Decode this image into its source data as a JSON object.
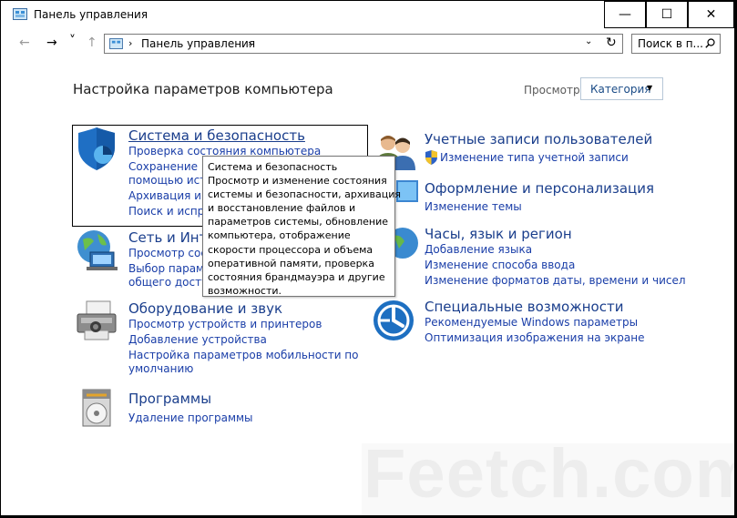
{
  "window": {
    "title": "Панель управления"
  },
  "controls": {
    "minimize": "—",
    "maximize": "☐",
    "close": "✕"
  },
  "nav": {
    "back": "←",
    "forward": "→",
    "recent": "˅",
    "up": "↑"
  },
  "address": {
    "path": "Панель управления",
    "sep1": "›",
    "sep2": "›",
    "dropdown": "⌄",
    "refresh": "↻"
  },
  "search": {
    "placeholder": "Поиск в п..."
  },
  "page": {
    "heading": "Настройка параметров компьютера",
    "view_label": "Просмотр:",
    "view_value": "Категория",
    "view_arrow": "▼"
  },
  "categories": {
    "security": {
      "title": "Система и безопасность",
      "icon": "shield-icon",
      "links": [
        "Проверка состояния компьютера",
        "Сохранение ре",
        "помощью исто",
        "Архивация и во",
        "Поиск и испра"
      ]
    },
    "network": {
      "title": "Сеть и Инте",
      "icon": "network-globe-icon",
      "links": [
        "Просмотр сост",
        "Выбор параме",
        "общего доступ"
      ]
    },
    "hardware": {
      "title": "Оборудование и звук",
      "icon": "printer-icon",
      "links": [
        "Просмотр устройств и принтеров",
        "Добавление устройства",
        "Настройка параметров мобильности по",
        "умолчанию"
      ]
    },
    "programs": {
      "title": "Программы",
      "icon": "programs-disc-icon",
      "links": [
        "Удаление программы"
      ]
    },
    "accounts": {
      "title": "Учетные записи пользователей",
      "icon": "users-icon",
      "links": [
        "Изменение типа учетной записи"
      ]
    },
    "appearance": {
      "title": "Оформление и персонализация",
      "icon": "appearance-icon",
      "links": [
        "Изменение темы"
      ]
    },
    "clock": {
      "title": "Часы, язык и регион",
      "icon": "clock-globe-icon",
      "links": [
        "Добавление языка",
        "Изменение способа ввода",
        "Изменение форматов даты, времени и чисел"
      ]
    },
    "access": {
      "title": "Специальные возможности",
      "icon": "ease-of-access-icon",
      "links": [
        "Рекомендуемые Windows параметры",
        "Оптимизация изображения на экране"
      ]
    }
  },
  "tooltip": {
    "lines": [
      "Система и безопасность",
      "Просмотр и изменение состояния",
      "системы и безопасности, архивация",
      "и восстановление файлов и",
      "параметров системы, обновление",
      "компьютера, отображение",
      "скорости процессора и объема",
      "оперативной памяти, проверка",
      "состояния брандмауэра и другие",
      "возможности."
    ]
  },
  "watermark": {
    "text": "Feetch.com"
  }
}
